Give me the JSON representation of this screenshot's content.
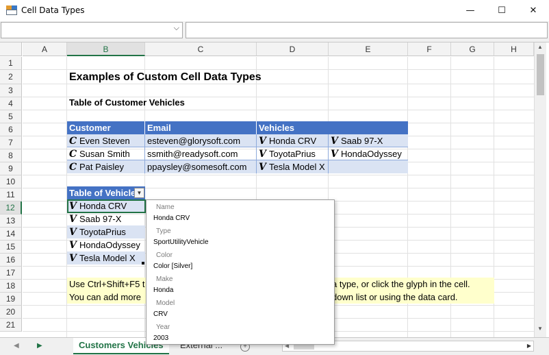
{
  "window": {
    "title": "Cell Data Types",
    "minimize": "—",
    "maximize": "☐",
    "close": "✕"
  },
  "formula_bar": {
    "name_box_value": "",
    "formula_value": "",
    "dropdown_glyph": "⌵"
  },
  "columns": [
    "A",
    "B",
    "C",
    "D",
    "E",
    "F",
    "G",
    "H"
  ],
  "rows": [
    "1",
    "2",
    "3",
    "4",
    "5",
    "6",
    "7",
    "8",
    "9",
    "10",
    "11",
    "12",
    "13",
    "14",
    "15",
    "16",
    "17",
    "18",
    "19",
    "20",
    "21"
  ],
  "selected_column": "B",
  "selected_row": "12",
  "glyphs": {
    "customer": "C",
    "vehicle": "V"
  },
  "sheet": {
    "title": "Examples of Custom Cell Data Types",
    "table1_title": "Table of Customer Vehicles",
    "table1_headers": [
      "Customer",
      "Email",
      "Vehicles"
    ],
    "table1_rows": [
      {
        "customer": "Even Steven",
        "email": "esteven@glorysoft.com",
        "vehicle1": "Honda CRV",
        "vehicle2": "Saab 97-X"
      },
      {
        "customer": "Susan Smith",
        "email": "ssmith@readysoft.com",
        "vehicle1": "ToyotaPrius",
        "vehicle2": "HondaOdyssey"
      },
      {
        "customer": "Pat Paisley",
        "email": "ppaysley@somesoft.com",
        "vehicle1": "Tesla Model X",
        "vehicle2": ""
      }
    ],
    "table2_header": "Table of Vehicles",
    "table2_rows": [
      "Honda CRV",
      "Saab 97-X",
      "ToyotaPrius",
      "HondaOdyssey",
      "Tesla Model X"
    ],
    "note1_left": "Use Ctrl+Shift+F5 t",
    "note1_right": "a type, or click the glyph in the cell.",
    "note2_left": "You can add more",
    "note2_right": "down list or using the data card."
  },
  "data_card": {
    "fields": [
      {
        "label": "Name",
        "value": "Honda CRV"
      },
      {
        "label": "Type",
        "value": "SportUtilityVehicle"
      },
      {
        "label": "Color",
        "value": "Color [Silver]"
      },
      {
        "label": "Make",
        "value": "Honda"
      },
      {
        "label": "Model",
        "value": "CRV"
      },
      {
        "label": "Year",
        "value": "2003"
      }
    ]
  },
  "tabs": {
    "active": "Customers Vehicles",
    "other": "External ..."
  },
  "colors": {
    "accent": "#217346",
    "table_header": "#4472c4",
    "table_band": "#dae3f3",
    "note_fill": "#ffffcc"
  }
}
